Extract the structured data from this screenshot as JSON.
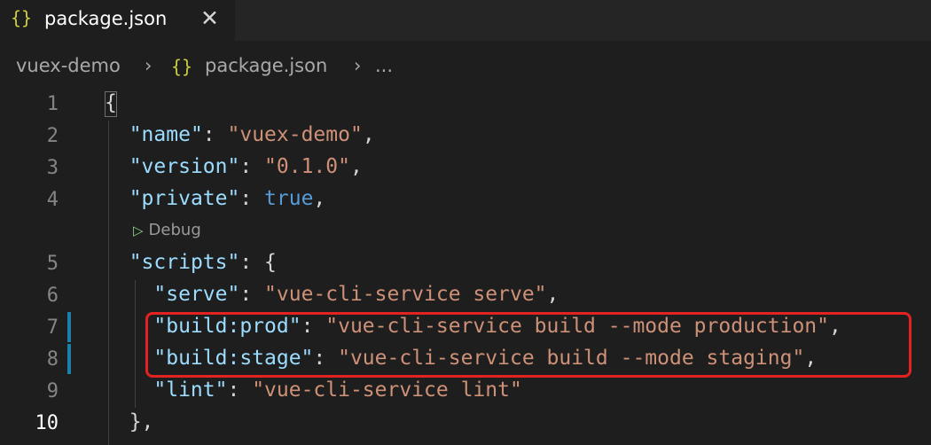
{
  "tab": {
    "icon": "{}",
    "label": "package.json",
    "close": "✕"
  },
  "breadcrumb": {
    "folder": "vuex-demo",
    "sep1": "›",
    "icon": "{}",
    "file": "package.json",
    "sep2": "›",
    "more": "..."
  },
  "codelens": {
    "icon": "play-icon",
    "label": "Debug"
  },
  "lines": [
    {
      "n": "1",
      "t": "{"
    },
    {
      "n": "2",
      "k": "\"name\"",
      "v": "\"vuex-demo\"",
      "end": ","
    },
    {
      "n": "3",
      "k": "\"version\"",
      "v": "\"0.1.0\"",
      "end": ","
    },
    {
      "n": "4",
      "k": "\"private\"",
      "v": "true",
      "end": ","
    },
    {
      "n": "5",
      "k": "\"scripts\"",
      "v": "{",
      "end": ""
    },
    {
      "n": "6",
      "k": "\"serve\"",
      "v": "\"vue-cli-service serve\"",
      "end": ","
    },
    {
      "n": "7",
      "k": "\"build:prod\"",
      "v": "\"vue-cli-service build --mode production\"",
      "end": ","
    },
    {
      "n": "8",
      "k": "\"build:stage\"",
      "v": "\"vue-cli-service build --mode staging\"",
      "end": ","
    },
    {
      "n": "9",
      "k": "\"lint\"",
      "v": "\"vue-cli-service lint\"",
      "end": ""
    },
    {
      "n": "10",
      "t": "},"
    }
  ],
  "colors": {
    "key": "#9cdcfe",
    "string": "#ce9178",
    "boolean": "#569cd6",
    "highlight_box": "#e32222",
    "modified_gutter": "#1b81a8"
  }
}
